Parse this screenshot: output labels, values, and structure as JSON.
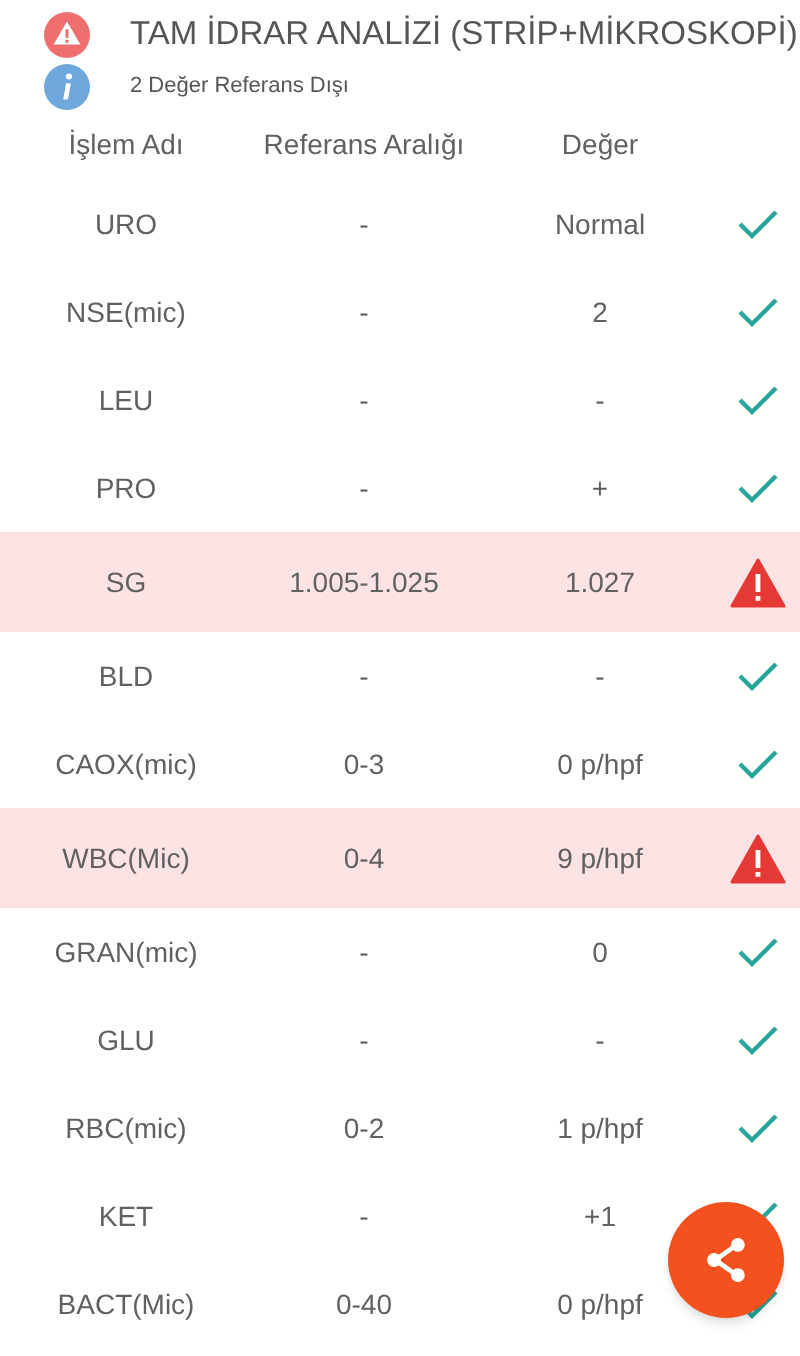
{
  "header": {
    "title": "TAM İDRAR ANALİZİ (STRİP+MİKROSKOPİ)",
    "subtitle": "2 Değer Referans Dışı"
  },
  "columns": [
    "İşlem Adı",
    "Referans Aralığı",
    "Değer"
  ],
  "rows": [
    {
      "name": "URO",
      "reference": "-",
      "value": "Normal",
      "out_of_range": false
    },
    {
      "name": "NSE(mic)",
      "reference": "-",
      "value": "2",
      "out_of_range": false
    },
    {
      "name": "LEU",
      "reference": "-",
      "value": "-",
      "out_of_range": false
    },
    {
      "name": "PRO",
      "reference": "-",
      "value": "+",
      "out_of_range": false
    },
    {
      "name": "SG",
      "reference": "1.005-1.025",
      "value": "1.027",
      "out_of_range": true
    },
    {
      "name": "BLD",
      "reference": "-",
      "value": "-",
      "out_of_range": false
    },
    {
      "name": "CAOX(mic)",
      "reference": "0-3",
      "value": "0 p/hpf",
      "out_of_range": false
    },
    {
      "name": "WBC(Mic)",
      "reference": "0-4",
      "value": "9 p/hpf",
      "out_of_range": true
    },
    {
      "name": "GRAN(mic)",
      "reference": "-",
      "value": "0",
      "out_of_range": false
    },
    {
      "name": "GLU",
      "reference": "-",
      "value": "-",
      "out_of_range": false
    },
    {
      "name": "RBC(mic)",
      "reference": "0-2",
      "value": "1 p/hpf",
      "out_of_range": false
    },
    {
      "name": "KET",
      "reference": "-",
      "value": "+1",
      "out_of_range": false
    },
    {
      "name": "BACT(Mic)",
      "reference": "0-40",
      "value": "0 p/hpf",
      "out_of_range": false
    }
  ]
}
